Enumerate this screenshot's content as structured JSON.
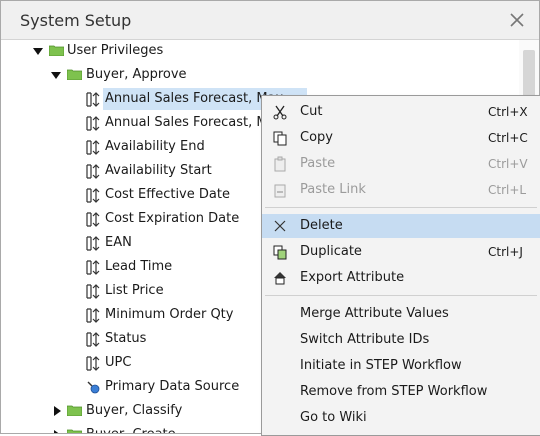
{
  "window": {
    "title": "System Setup"
  },
  "tree": {
    "root": {
      "label": "User Privileges"
    },
    "group1": {
      "label": "Buyer, Approve"
    },
    "items": [
      "Annual Sales Forecast, Max",
      "Annual Sales Forecast, Min",
      "Availability End",
      "Availability Start",
      "Cost Effective Date",
      "Cost Expiration Date",
      "EAN",
      "Lead Time",
      "List Price",
      "Minimum Order Qty",
      "Status",
      "UPC"
    ],
    "primary_source": "Primary Data Source",
    "group2": {
      "label": "Buyer, Classify"
    },
    "group3": {
      "label": "Buyer, Create"
    }
  },
  "context_menu": {
    "cut": {
      "label": "Cut",
      "shortcut": "Ctrl+X"
    },
    "copy": {
      "label": "Copy",
      "shortcut": "Ctrl+C"
    },
    "paste": {
      "label": "Paste",
      "shortcut": "Ctrl+V"
    },
    "paste_link": {
      "label": "Paste Link",
      "shortcut": "Ctrl+L"
    },
    "delete": {
      "label": "Delete"
    },
    "duplicate": {
      "label": "Duplicate",
      "shortcut": "Ctrl+J"
    },
    "export": {
      "label": "Export Attribute"
    },
    "merge": {
      "label": "Merge Attribute Values"
    },
    "switch_ids": {
      "label": "Switch Attribute IDs"
    },
    "initiate": {
      "label": "Initiate in STEP Workflow"
    },
    "remove": {
      "label": "Remove from STEP Workflow"
    },
    "wiki": {
      "label": "Go to Wiki"
    }
  },
  "colors": {
    "selection": "#cfe3f6",
    "menu_highlight": "#c6dcf2",
    "folder": "#7ec24e"
  }
}
